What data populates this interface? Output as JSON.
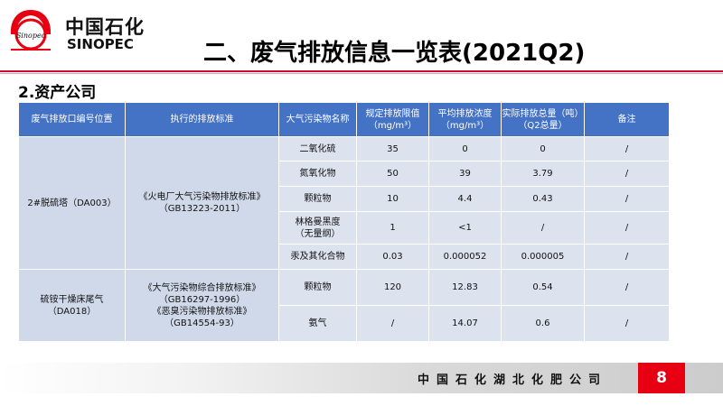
{
  "brand": {
    "name_cn": "中国石化",
    "name_en": "SINOPEC"
  },
  "title": "二、废气排放信息一览表(2021Q2)",
  "section_title": "2.资产公司",
  "table": {
    "headers": {
      "outlet": "废气排放口编号位置",
      "standard": "执行的排放标准",
      "pollutant": "大气污染物名称",
      "limit_l1": "规定排放限值",
      "limit_l2": "（mg/m³）",
      "avg_l1": "平均排放浓度",
      "avg_l2": "（mg/m³）",
      "total_l1": "实际排放总量（吨）",
      "total_l2": "（Q2总量）",
      "remark": "备注"
    },
    "groups": [
      {
        "outlet": "2#脱硫塔（DA003）",
        "standard_l1": "《火电厂大气污染物排放标准》",
        "standard_l2": "（GB13223-2011）",
        "rows": [
          {
            "pollutant": "二氧化硫",
            "pollutant_l2": "",
            "limit": "35",
            "avg": "0",
            "total": "0",
            "remark": "/"
          },
          {
            "pollutant": "氮氧化物",
            "pollutant_l2": "",
            "limit": "50",
            "avg": "39",
            "total": "3.79",
            "remark": "/"
          },
          {
            "pollutant": "颗粒物",
            "pollutant_l2": "",
            "limit": "10",
            "avg": "4.4",
            "total": "0.43",
            "remark": "/"
          },
          {
            "pollutant": "林格曼黑度",
            "pollutant_l2": "（无量纲）",
            "limit": "1",
            "avg": "<1",
            "total": "/",
            "remark": "/"
          },
          {
            "pollutant": "汞及其化合物",
            "pollutant_l2": "",
            "limit": "0.03",
            "avg": "0.000052",
            "total": "0.000005",
            "remark": "/"
          }
        ]
      },
      {
        "outlet_l1": "硫铵干燥床尾气",
        "outlet_l2": "（DA018）",
        "standard_l1": "《大气污染物综合排放标准》",
        "standard_l2": "（GB16297-1996）",
        "standard_l3": "《恶臭污染物排放标准》",
        "standard_l4": "（GB14554-93）",
        "rows": [
          {
            "pollutant": "颗粒物",
            "limit": "120",
            "avg": "12.83",
            "total": "0.54",
            "remark": "/"
          },
          {
            "pollutant": "氨气",
            "limit": "/",
            "avg": "14.07",
            "total": "0.6",
            "remark": "/"
          }
        ]
      }
    ]
  },
  "footer": {
    "company": "中国石化湖北化肥公司",
    "page": "8"
  },
  "colors": {
    "header_bg": "#4472c4",
    "cell_bg": "#dde3ee",
    "accent": "#e60012"
  }
}
